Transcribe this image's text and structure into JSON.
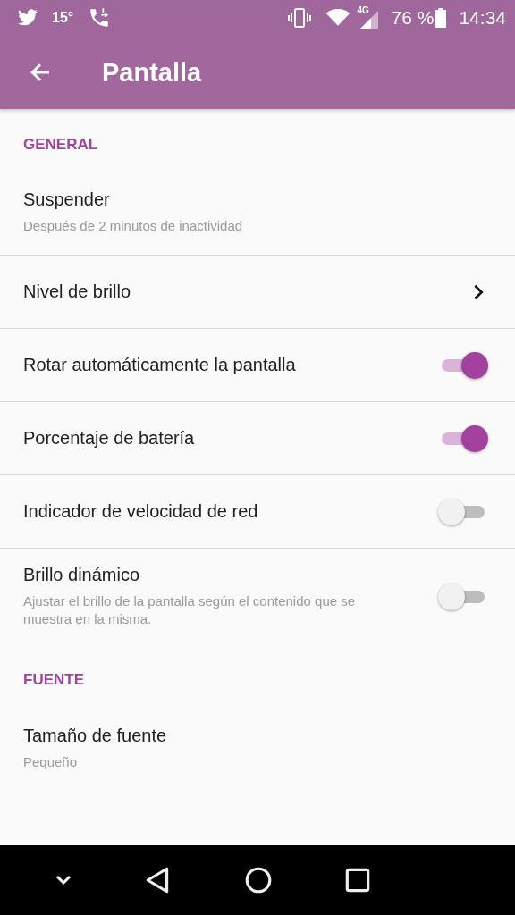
{
  "status_bar": {
    "temperature": "15°",
    "network": "4G",
    "battery_percent": "76 %",
    "time": "14:34"
  },
  "app_bar": {
    "title": "Pantalla"
  },
  "sections": [
    {
      "header": "GENERAL",
      "items": [
        {
          "kind": "plain",
          "title": "Suspender",
          "subtitle": "Después de 2 minutos de inactividad"
        },
        {
          "kind": "chevron",
          "title": "Nivel de brillo"
        },
        {
          "kind": "switch",
          "title": "Rotar automáticamente la pantalla",
          "on": true
        },
        {
          "kind": "switch",
          "title": "Porcentaje de batería",
          "on": true
        },
        {
          "kind": "switch",
          "title": "Indicador de velocidad de red",
          "on": false
        },
        {
          "kind": "switch",
          "title": "Brillo dinámico",
          "subtitle": "Ajustar el brillo de la pantalla según el contenido que se muestra en la misma.",
          "on": false
        }
      ]
    },
    {
      "header": "FUENTE",
      "items": [
        {
          "kind": "plain",
          "title": "Tamaño de fuente",
          "subtitle": "Pequeño"
        }
      ]
    }
  ]
}
